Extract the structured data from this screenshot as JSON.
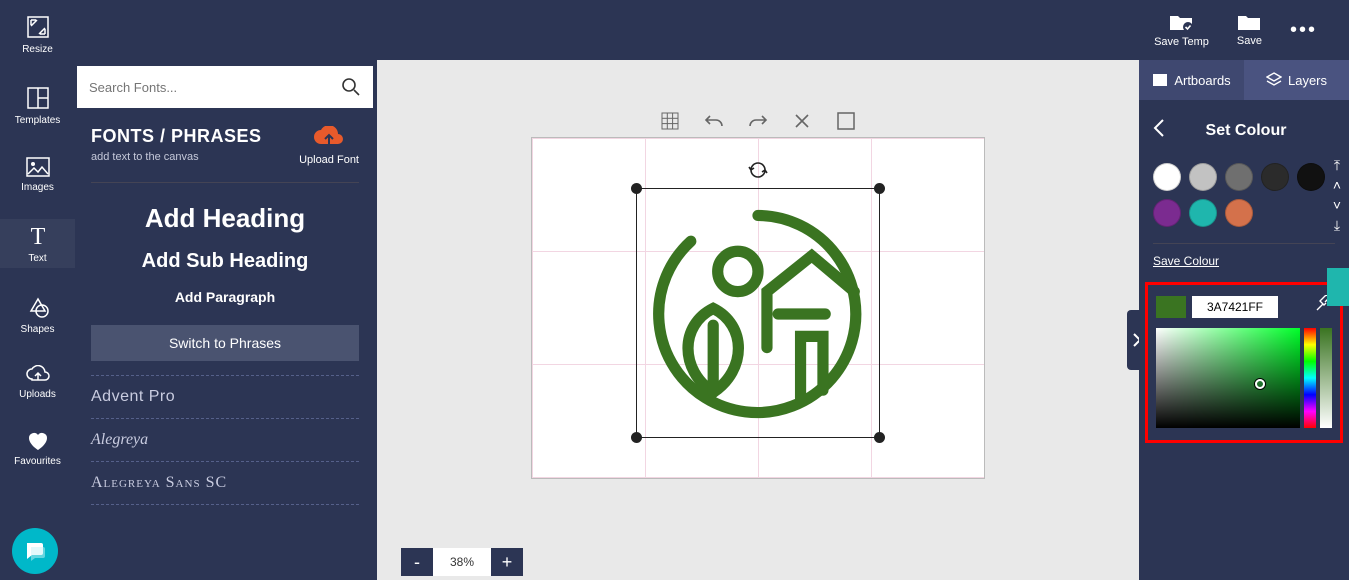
{
  "topbar": {
    "save_temp": "Save Temp",
    "save": "Save"
  },
  "rail": {
    "resize": "Resize",
    "templates": "Templates",
    "images": "Images",
    "text": "Text",
    "shapes": "Shapes",
    "uploads": "Uploads",
    "favourites": "Favourites"
  },
  "fonts_panel": {
    "search_placeholder": "Search Fonts...",
    "title": "FONTS / PHRASES",
    "subtitle": "add text to the canvas",
    "upload_font": "Upload Font",
    "add_heading": "Add Heading",
    "add_subheading": "Add Sub Heading",
    "add_paragraph": "Add Paragraph",
    "switch": "Switch to Phrases",
    "fonts": [
      "Advent Pro",
      "Alegreya",
      "Alegreya Sans SC"
    ]
  },
  "canvas": {
    "zoom": "38%"
  },
  "right_panel": {
    "tab_artboards": "Artboards",
    "tab_layers": "Layers",
    "title": "Set Colour",
    "save_colour": "Save Colour",
    "hex": "3A7421FF",
    "swatches": [
      "#ffffff",
      "#c2c2c2",
      "#6f6f6f",
      "#2b2b2b",
      "#111111",
      "#7b2b90",
      "#1fb6ad",
      "#d4714b"
    ]
  }
}
